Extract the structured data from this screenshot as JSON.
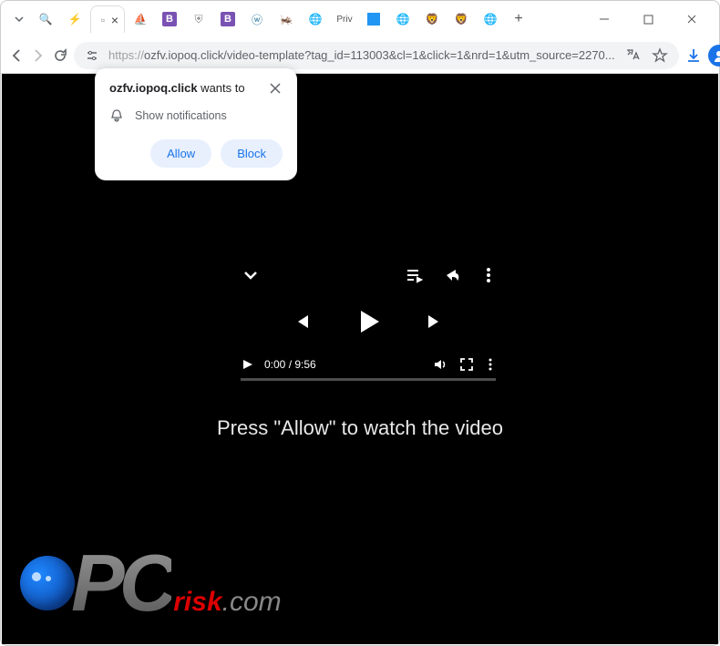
{
  "window": {
    "tabs": [
      {
        "icon": "globe-search",
        "color": "#888"
      },
      {
        "icon": "lightning",
        "color": "#f5a623"
      },
      {
        "icon": "page",
        "color": "#888",
        "active": true
      },
      {
        "icon": "ship",
        "color": "#7b5c3e"
      },
      {
        "icon": "b-square",
        "color": "#7952b3"
      },
      {
        "icon": "shield",
        "color": "#888"
      },
      {
        "icon": "b-square",
        "color": "#7952b3"
      },
      {
        "icon": "wordpress",
        "color": "#21759b"
      },
      {
        "icon": "bug",
        "color": "#e07a3f"
      },
      {
        "icon": "globe",
        "color": "#888"
      },
      {
        "icon": "text",
        "label": "Priv",
        "color": "#555"
      },
      {
        "icon": "square",
        "color": "#2196f3"
      },
      {
        "icon": "globe",
        "color": "#888"
      },
      {
        "icon": "brave",
        "color": "#fb542b"
      },
      {
        "icon": "brave",
        "color": "#fb542b"
      },
      {
        "icon": "globe",
        "color": "#888"
      }
    ]
  },
  "toolbar": {
    "url_scheme": "https://",
    "url_rest": "ozfv.iopoq.click/video-template?tag_id=113003&cl=1&click=1&nrd=1&utm_source=2270..."
  },
  "notification": {
    "domain": "ozfv.iopoq.click",
    "wants_to": " wants to",
    "body": "Show notifications",
    "allow": "Allow",
    "block": "Block"
  },
  "player": {
    "current_time": "0:00",
    "separator": " / ",
    "duration": "9:56"
  },
  "instruction": "Press \"Allow\" to watch the video",
  "watermark": {
    "pc": "PC",
    "risk": "risk",
    "com": ".com"
  }
}
